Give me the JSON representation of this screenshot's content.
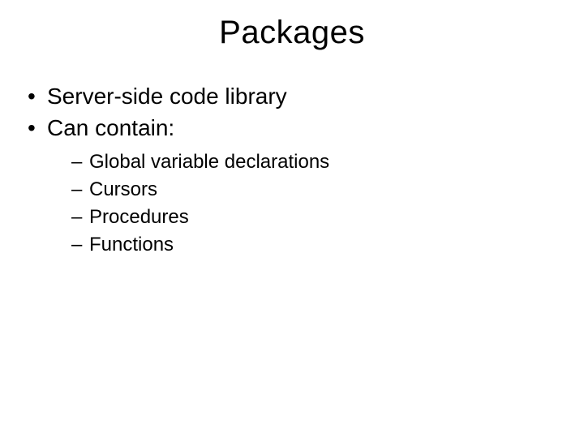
{
  "title": "Packages",
  "bullets": [
    {
      "text": "Server-side code library"
    },
    {
      "text": "Can contain:",
      "sub": [
        "Global variable declarations",
        "Cursors",
        "Procedures",
        "Functions"
      ]
    }
  ]
}
